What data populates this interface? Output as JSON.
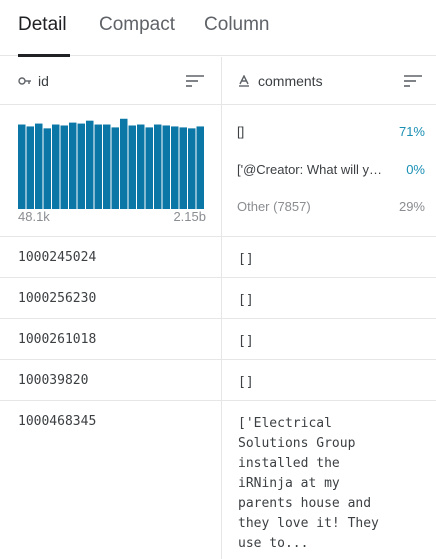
{
  "tabs": [
    {
      "label": "Detail",
      "active": true
    },
    {
      "label": "Compact",
      "active": false
    },
    {
      "label": "Column",
      "active": false
    }
  ],
  "columns": {
    "id": {
      "name": "id",
      "type_icon": "key-icon"
    },
    "comments": {
      "name": "comments",
      "type_icon": "string-type-icon"
    }
  },
  "summary": {
    "id": {
      "min_label": "48.1k",
      "max_label": "2.15b",
      "bars": [
        0.88,
        0.86,
        0.89,
        0.84,
        0.88,
        0.87,
        0.9,
        0.89,
        0.92,
        0.88,
        0.88,
        0.85,
        0.94,
        0.87,
        0.88,
        0.85,
        0.88,
        0.87,
        0.86,
        0.85,
        0.84,
        0.86
      ]
    },
    "comments": [
      {
        "label": "[]",
        "pct": "71%"
      },
      {
        "label": "['@Creator: What will you make next?']",
        "pct": "0%"
      },
      {
        "label": "Other (7857)",
        "pct": "29%"
      }
    ]
  },
  "rows": [
    {
      "id": "1000245024",
      "comments": "[]"
    },
    {
      "id": "1000256230",
      "comments": "[]"
    },
    {
      "id": "1000261018",
      "comments": "[]"
    },
    {
      "id": "100039820",
      "comments": "[]"
    },
    {
      "id": "1000468345",
      "comments": "['Electrical\nSolutions Group\ninstalled the\niRNinja at my\nparents house and\nthey love it! They\nuse to..."
    }
  ],
  "colors": {
    "histogram_bar": "#0b77a6",
    "accent_pct": "#1a8fb4"
  }
}
